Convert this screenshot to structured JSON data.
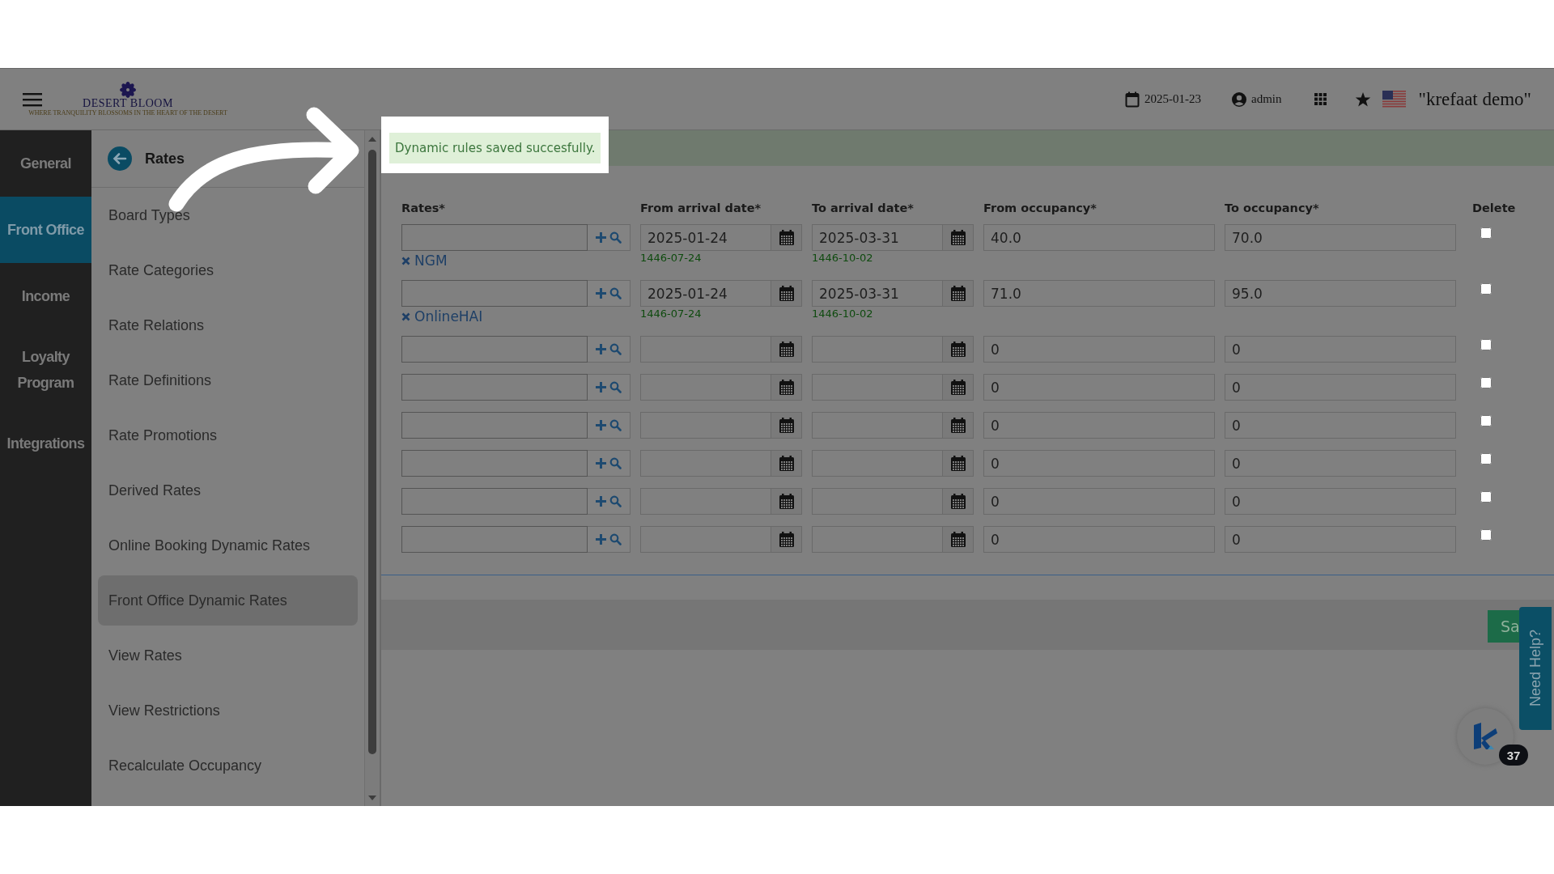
{
  "header": {
    "logo": {
      "name": "DESERT BLOOM",
      "tagline": "WHERE TRANQUILITY BLOSSOMS IN THE HEART OF THE DESERT"
    },
    "date": "2025-01-23",
    "user": "admin",
    "property": "\"krefaat demo\""
  },
  "modules": [
    {
      "label": "General",
      "selected": false
    },
    {
      "label": "Front Office",
      "selected": true
    },
    {
      "label": "Income",
      "selected": false
    },
    {
      "label": "Loyalty Program",
      "selected": false
    },
    {
      "label": "Integrations",
      "selected": false
    }
  ],
  "submenu": {
    "title": "Rates",
    "items": [
      {
        "label": "Board Types",
        "selected": false
      },
      {
        "label": "Rate Categories",
        "selected": false
      },
      {
        "label": "Rate Relations",
        "selected": false
      },
      {
        "label": "Rate Definitions",
        "selected": false
      },
      {
        "label": "Rate Promotions",
        "selected": false
      },
      {
        "label": "Derived Rates",
        "selected": false
      },
      {
        "label": "Online Booking Dynamic Rates",
        "selected": false
      },
      {
        "label": "Front Office Dynamic Rates",
        "selected": true
      },
      {
        "label": "View Rates",
        "selected": false
      },
      {
        "label": "View Restrictions",
        "selected": false
      },
      {
        "label": "Recalculate Occupancy",
        "selected": false
      }
    ]
  },
  "notification": {
    "message": "Dynamic rules saved succesfully."
  },
  "table": {
    "columns": [
      "Rates*",
      "From arrival date*",
      "To arrival date*",
      "From occupancy*",
      "To occupancy*",
      "Delete"
    ],
    "rows": [
      {
        "rate_tag": "NGM",
        "from_date": "2025-01-24",
        "from_hijri": "1446-07-24",
        "to_date": "2025-03-31",
        "to_hijri": "1446-10-02",
        "from_occupancy": "40.0",
        "to_occupancy": "70.0",
        "delete": false
      },
      {
        "rate_tag": "OnlineHAI",
        "from_date": "2025-01-24",
        "from_hijri": "1446-07-24",
        "to_date": "2025-03-31",
        "to_hijri": "1446-10-02",
        "from_occupancy": "71.0",
        "to_occupancy": "95.0",
        "delete": false
      },
      {
        "from_occupancy": "0",
        "to_occupancy": "0",
        "delete": false
      },
      {
        "from_occupancy": "0",
        "to_occupancy": "0",
        "delete": false
      },
      {
        "from_occupancy": "0",
        "to_occupancy": "0",
        "delete": false
      },
      {
        "from_occupancy": "0",
        "to_occupancy": "0",
        "delete": false
      },
      {
        "from_occupancy": "0",
        "to_occupancy": "0",
        "delete": false
      },
      {
        "from_occupancy": "0",
        "to_occupancy": "0",
        "delete": false
      }
    ]
  },
  "save_button": "Sa",
  "help_tab": "Need Help?",
  "chat_badge": "37"
}
